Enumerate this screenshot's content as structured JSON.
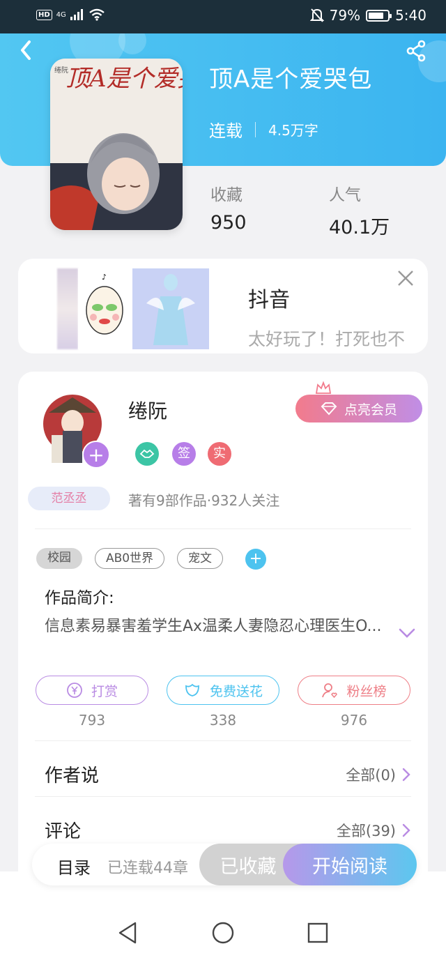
{
  "status_bar": {
    "hd": "HD",
    "network": "4G",
    "battery_text": "79%",
    "battery_level": 0.79,
    "time": "5:40"
  },
  "book": {
    "title": "顶A是个爱哭包",
    "status": "连载",
    "word_count": "4.5万字",
    "cover_title": "顶A是个爱哭包",
    "cover_author": "绻阮",
    "stats": [
      {
        "label": "收藏",
        "value": "950"
      },
      {
        "label": "人气",
        "value": "40.1万"
      }
    ]
  },
  "ad": {
    "title": "抖音",
    "description": "太好玩了！打死也不"
  },
  "author": {
    "name": "绻阮",
    "badges": [
      "签",
      "实"
    ],
    "vip_button": "点亮会员",
    "fan_badge": "范丞丞",
    "info": "著有9部作品·932人关注"
  },
  "tags": [
    {
      "label": "校园",
      "style": "filled"
    },
    {
      "label": "AB0世界",
      "style": "outline"
    },
    {
      "label": "宠文",
      "style": "outline"
    }
  ],
  "intro": {
    "label": "作品简介:",
    "text": "信息素易暴害羞学生Ax温柔人妻隐忍心理医生O..."
  },
  "actions": [
    {
      "label": "打赏",
      "count": "793",
      "color": "#b98be3",
      "icon": "yen-coin-icon"
    },
    {
      "label": "免费送花",
      "count": "338",
      "color": "#4dc3ef",
      "icon": "flower-icon"
    },
    {
      "label": "粉丝榜",
      "count": "976",
      "color": "#ee7e86",
      "icon": "fan-user-icon"
    }
  ],
  "sections": [
    {
      "title": "作者说",
      "more": "全部(0)"
    },
    {
      "title": "评论",
      "more": "全部(39)"
    }
  ],
  "bottom_bar": {
    "toc": "目录",
    "toc_sub": "已连载44章",
    "collect": "已收藏",
    "read": "开始阅读"
  },
  "colors": {
    "header_blue": "#3bb4f0",
    "accent_purple": "#b77ee8",
    "vip_pink": "#f27b8c"
  }
}
